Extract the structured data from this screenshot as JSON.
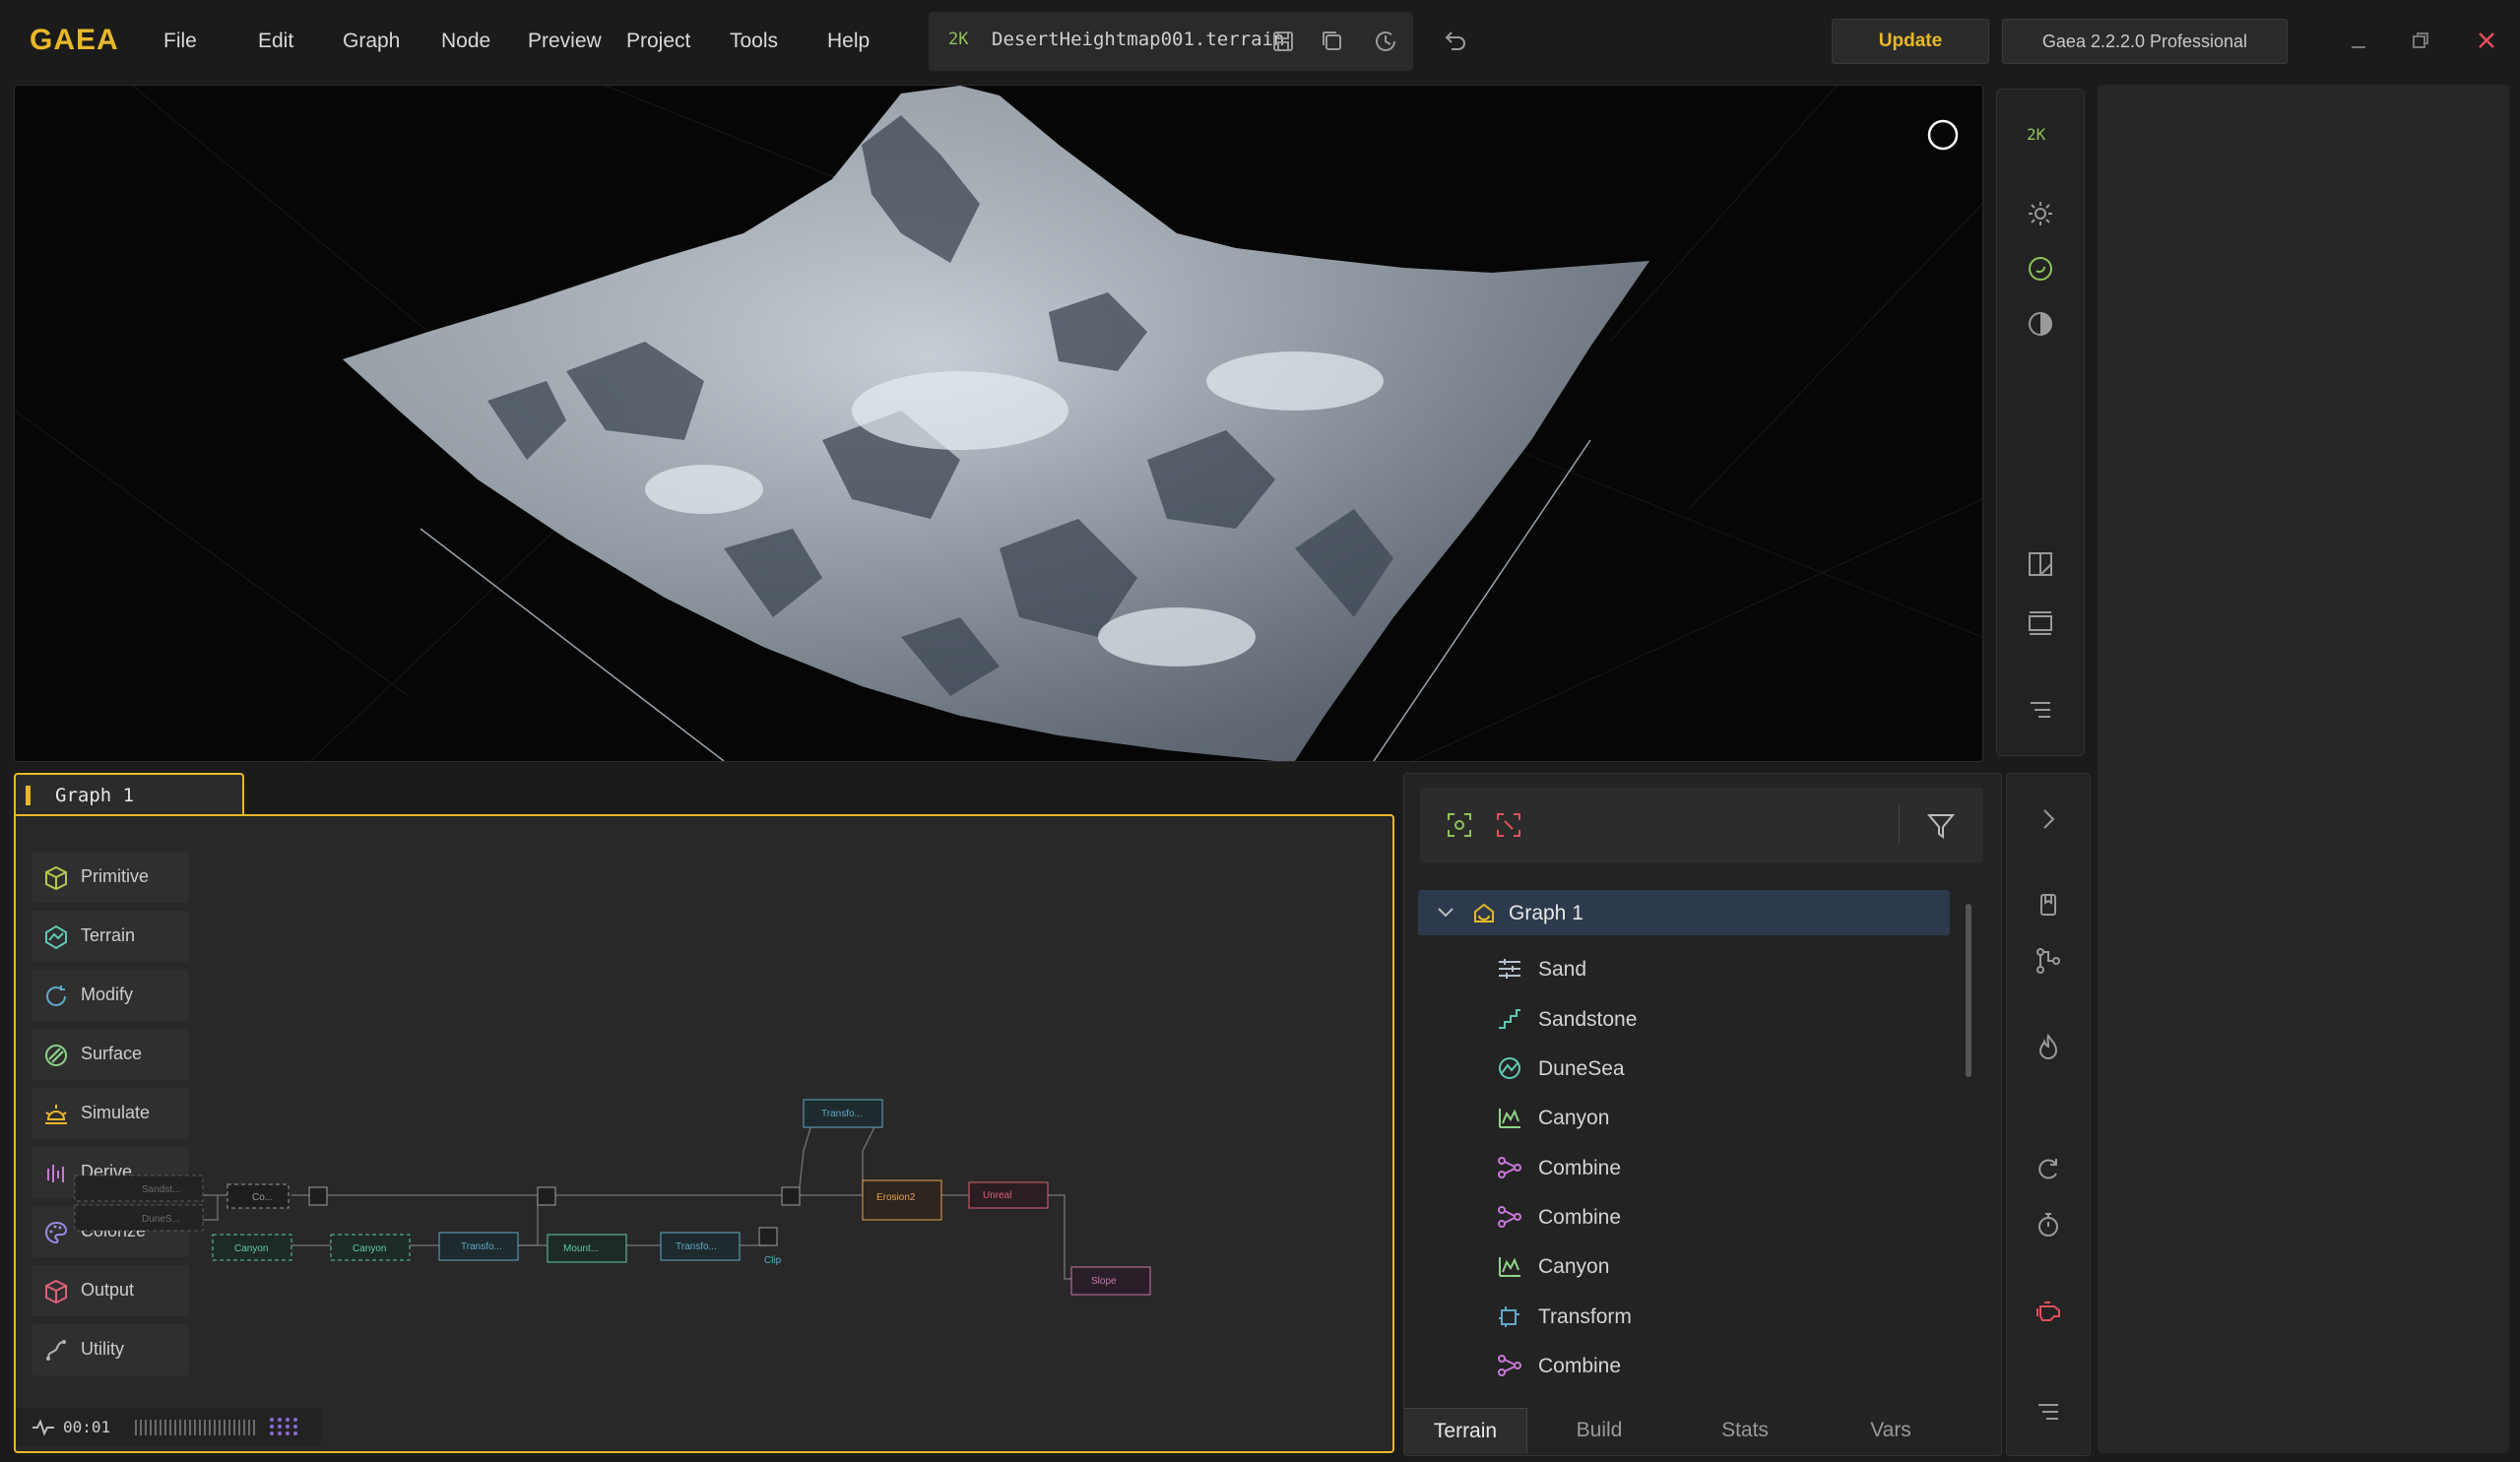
{
  "app": {
    "logo": "GAEA"
  },
  "menu": [
    "File",
    "Edit",
    "Graph",
    "Node",
    "Preview",
    "Project",
    "Tools",
    "Help"
  ],
  "file": {
    "resolution": "2K",
    "name": "DesertHeightmap001.terrain"
  },
  "header": {
    "update_label": "Update",
    "version_label": "Gaea 2.2.2.0 Professional"
  },
  "viewport_tools": {
    "resolution": "2K"
  },
  "graph": {
    "tab_label": "Graph 1",
    "categories": [
      "Primitive",
      "Terrain",
      "Modify",
      "Surface",
      "Simulate",
      "Derive",
      "Colorize",
      "Output",
      "Utility"
    ],
    "nodes": {
      "co": "Co...",
      "canyon1": "Canyon",
      "canyon2": "Canyon",
      "transfo1": "Transfo...",
      "mount": "Mount...",
      "transfo2": "Transfo...",
      "transfo3": "Transfo...",
      "erosion2": "Erosion2",
      "unreal": "Unreal",
      "slope": "Slope",
      "sandst": "Sandst...",
      "dunes": "DuneS...",
      "clip": "Clip"
    },
    "timer": "00:01"
  },
  "node_list": {
    "root": "Graph 1",
    "items": [
      "Sand",
      "Sandstone",
      "DuneSea",
      "Canyon",
      "Combine",
      "Combine",
      "Canyon",
      "Transform",
      "Combine"
    ],
    "tabs": [
      "Terrain",
      "Build",
      "Stats",
      "Vars"
    ]
  },
  "colors": {
    "accent": "#e8b82a",
    "green": "#8fc45a",
    "teal": "#5fc9b3",
    "red": "#e0505a",
    "selection": "#2d3a4d"
  }
}
